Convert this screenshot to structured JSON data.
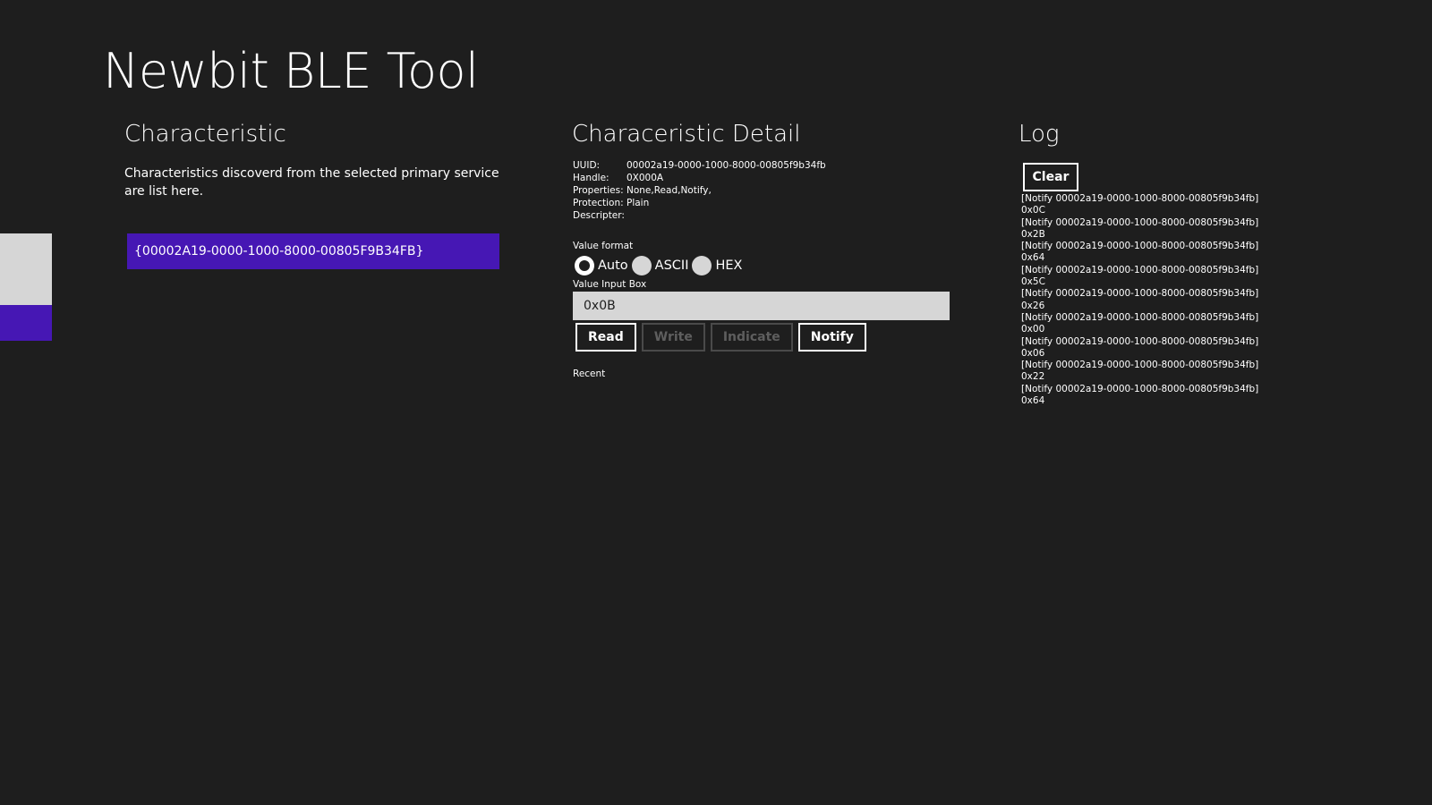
{
  "app": {
    "title": "Newbit BLE Tool"
  },
  "characteristic": {
    "heading": "Characteristic",
    "description": "Characteristics discoverd from the selected primary service are list here.",
    "items": [
      {
        "label": "{00002A19-0000-1000-8000-00805F9B34FB}",
        "selected": true
      }
    ]
  },
  "detail": {
    "heading": "Characeristic Detail",
    "rows": [
      {
        "key": "UUID:",
        "value": "00002a19-0000-1000-8000-00805f9b34fb"
      },
      {
        "key": "Handle:",
        "value": "0X000A"
      },
      {
        "key": "Properties:",
        "value": "None,Read,Notify,"
      },
      {
        "key": "Protection:",
        "value": "Plain"
      },
      {
        "key": "Descripter:",
        "value": ""
      }
    ],
    "value_format_label": "Value format",
    "formats": [
      {
        "label": "Auto",
        "selected": true
      },
      {
        "label": "ASCII",
        "selected": false
      },
      {
        "label": "HEX",
        "selected": false
      }
    ],
    "value_input_label": "Value Input Box",
    "value_input": "0x0B",
    "buttons": {
      "read": "Read",
      "write": "Write",
      "indicate": "Indicate",
      "notify": "Notify"
    },
    "recent_label": "Recent"
  },
  "log": {
    "heading": "Log",
    "clear_label": "Clear",
    "entries": [
      "[Notify 00002a19-0000-1000-8000-00805f9b34fb]",
      "0x0C",
      "[Notify 00002a19-0000-1000-8000-00805f9b34fb]",
      "0x2B",
      "[Notify 00002a19-0000-1000-8000-00805f9b34fb]",
      "0x64",
      "[Notify 00002a19-0000-1000-8000-00805f9b34fb]",
      "0x5C",
      "[Notify 00002a19-0000-1000-8000-00805f9b34fb]",
      "0x26",
      "[Notify 00002a19-0000-1000-8000-00805f9b34fb]",
      "0x00",
      "[Notify 00002a19-0000-1000-8000-00805f9b34fb]",
      "0x06",
      "[Notify 00002a19-0000-1000-8000-00805f9b34fb]",
      "0x22",
      "[Notify 00002a19-0000-1000-8000-00805f9b34fb]",
      "0x64"
    ]
  },
  "colors": {
    "background": "#1e1e1e",
    "accent": "#4617b4",
    "tile_gray": "#d6d6d6"
  }
}
